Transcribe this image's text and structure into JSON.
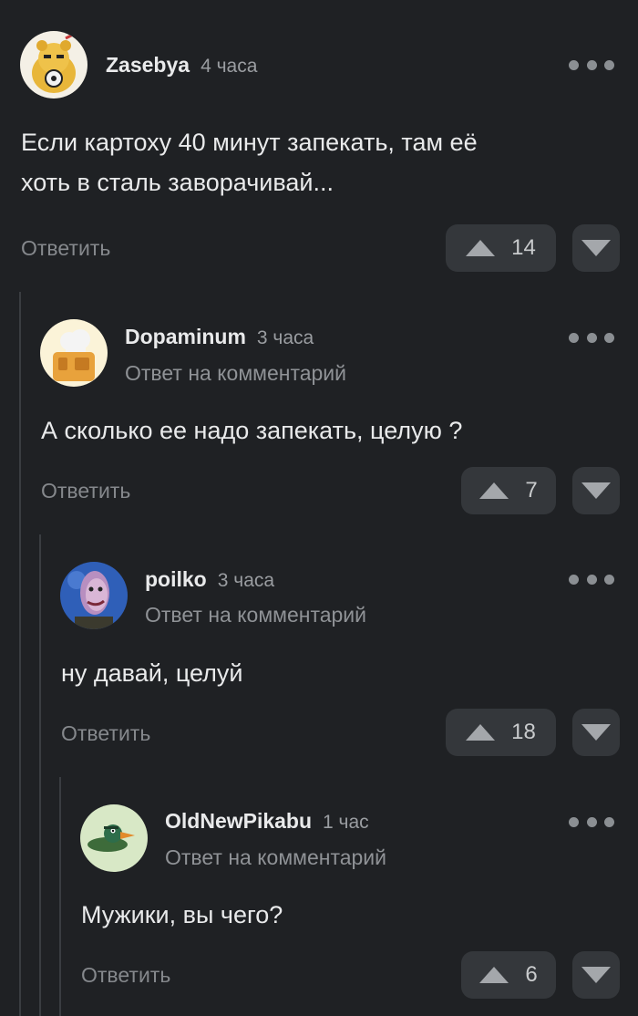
{
  "comments": [
    {
      "author": "Zasebya",
      "time": "4 часа",
      "reply_to": "",
      "text_lines": [
        "Если картоху 40 минут запекать, там её",
        "хоть в сталь заворачивай..."
      ],
      "reply_label": "Ответить",
      "votes": "14"
    },
    {
      "author": "Dopaminum",
      "time": "3 часа",
      "reply_to": "Ответ на комментарий",
      "text_lines": [
        "А сколько ее надо запекать, целую ?"
      ],
      "reply_label": "Ответить",
      "votes": "7"
    },
    {
      "author": "poilko",
      "time": "3 часа",
      "reply_to": "Ответ на комментарий",
      "text_lines": [
        "ну давай, целуй"
      ],
      "reply_label": "Ответить",
      "votes": "18"
    },
    {
      "author": "OldNewPikabu",
      "time": "1 час",
      "reply_to": "Ответ на комментарий",
      "text_lines": [
        "Мужики, вы чего?"
      ],
      "reply_label": "Ответить",
      "votes": "6"
    }
  ],
  "icons": {
    "more": "more-dots-icon",
    "upvote": "upvote-arrow-icon",
    "downvote": "downvote-arrow-icon"
  },
  "colors": {
    "background": "#1f2124",
    "button": "#34373b",
    "muted_text": "#85888c"
  }
}
